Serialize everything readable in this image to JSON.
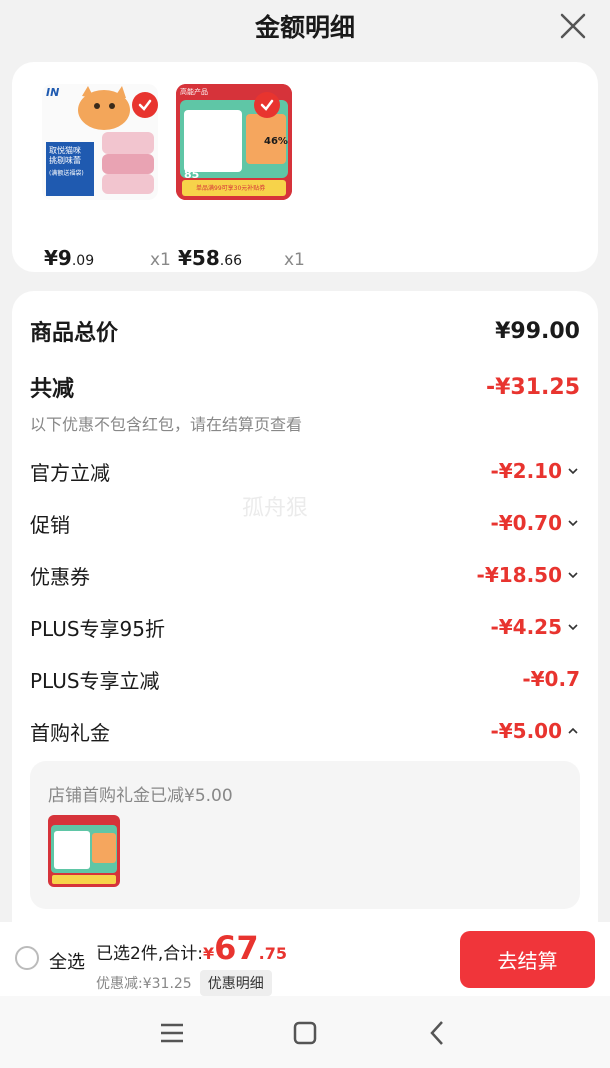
{
  "header": {
    "title": "金额明细"
  },
  "products": [
    {
      "price_main": "¥9",
      "price_dec": ".09",
      "qty": "x1"
    },
    {
      "price_main": "¥58",
      "price_dec": ".66",
      "qty": "x1"
    }
  ],
  "thumb1": {
    "brand": "IN ",
    "badge": "取悦猫咪\n挑剔味蕾",
    "badge_sub": "(满额送福袋)"
  },
  "thumb2": {
    "top_tag": "高能产品",
    "percent": "46%",
    "promo": "单品满99可享30元补贴券",
    "num": "85"
  },
  "summary": {
    "total_label": "商品总价",
    "total_value": "¥99.00",
    "discount_label": "共减",
    "discount_value": "-¥31.25",
    "note": "以下优惠不包含红包，请在结算页查看"
  },
  "discounts": [
    {
      "label": "官方立减",
      "value": "-¥2.10",
      "arrow": "down"
    },
    {
      "label": "促销",
      "value": "-¥0.70",
      "arrow": "down"
    },
    {
      "label": "优惠券",
      "value": "-¥18.50",
      "arrow": "down"
    },
    {
      "label": "PLUS专享95折",
      "value": "-¥4.25",
      "arrow": "down"
    },
    {
      "label": "PLUS专享立减",
      "value": "-¥0.7",
      "arrow": "none"
    },
    {
      "label": "首购礼金",
      "value": "-¥5.00",
      "arrow": "up"
    }
  ],
  "gift": {
    "text": "店铺首购礼金已减¥5.00"
  },
  "watermark": "孤舟狠",
  "bottom": {
    "select_all": "全选",
    "selected": "已选2件,合计:",
    "total_sym": "¥",
    "total_int": "67",
    "total_dec": ".75",
    "saved": "优惠减:¥31.25",
    "detail_btn": "优惠明细",
    "checkout": "去结算"
  },
  "colors": {
    "accent": "#e8342f",
    "checkout": "#f0353a"
  }
}
